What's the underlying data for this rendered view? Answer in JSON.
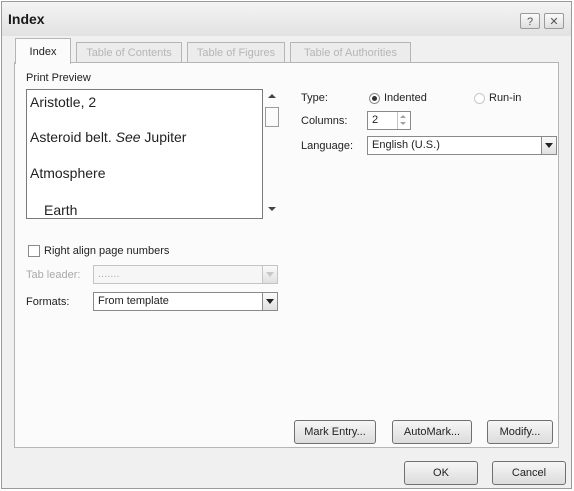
{
  "window": {
    "title": "Index",
    "help_glyph": "?",
    "close_glyph": "✕"
  },
  "tabs": [
    {
      "label": "Index",
      "active": true
    },
    {
      "label": "Table of Contents",
      "active": false
    },
    {
      "label": "Table of Figures",
      "active": false
    },
    {
      "label": "Table of Authorities",
      "active": false
    }
  ],
  "print_preview": {
    "label": "Print Preview",
    "entries": [
      {
        "text": "Aristotle, 2"
      },
      {
        "text": "Asteroid belt. ",
        "italic": "See",
        "tail": " Jupiter"
      },
      {
        "text": "Atmosphere"
      },
      {
        "text": "Earth"
      }
    ]
  },
  "type": {
    "label": "Type:",
    "options": [
      "Indented",
      "Run-in"
    ],
    "selected": "Indented"
  },
  "columns": {
    "label": "Columns:",
    "value": "2"
  },
  "language": {
    "label": "Language:",
    "value": "English (U.S.)"
  },
  "right_align": {
    "label": "Right align page numbers",
    "checked": false
  },
  "tab_leader": {
    "label": "Tab leader:",
    "value": ".......",
    "enabled": false
  },
  "formats": {
    "label": "Formats:",
    "value": "From template"
  },
  "buttons": {
    "mark_entry": "Mark Entry...",
    "automark": "AutoMark...",
    "modify": "Modify...",
    "ok": "OK",
    "cancel": "Cancel"
  },
  "colors": {
    "dialog_bg": "#f0f0f0",
    "panel_bg": "#fbfbfb",
    "disabled_text": "#a9a9a9"
  }
}
